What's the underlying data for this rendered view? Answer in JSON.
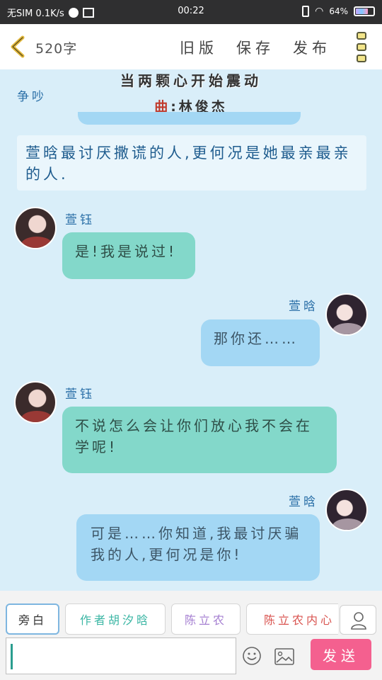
{
  "status": {
    "carrier": "无SIM 0.1K/s",
    "time": "00:22",
    "battery": "64%",
    "battery_level": 0.64
  },
  "topbar": {
    "word_count": "520字",
    "old_version": "旧版",
    "save": "保存",
    "publish": "发布"
  },
  "song": {
    "title": "当两颗心开始震动",
    "artist_prefix": "曲",
    "artist": ":林俊杰"
  },
  "scene_label": "争吵",
  "narration": "萱晗最讨厌撒谎的人,更何况是她最亲最亲的人.",
  "messages": [
    {
      "speaker": "萱钰",
      "side": "left",
      "text": "是!我是说过!"
    },
    {
      "speaker": "萱晗",
      "side": "right",
      "text": "那你还……"
    },
    {
      "speaker": "萱钰",
      "side": "left",
      "text": "不说怎么会让你们放心我不会在学呢!"
    },
    {
      "speaker": "萱晗",
      "side": "right",
      "text": "可是……你知道,我最讨厌骗我的人,更何况是你!"
    }
  ],
  "roles": [
    "旁白",
    "作者胡汐晗",
    "陈立农",
    "陈立农内心"
  ],
  "input": {
    "value": "",
    "placeholder": ""
  },
  "send_label": "发送",
  "colors": {
    "accent": "#f4608f",
    "left_bubble": "#83d8ca",
    "right_bubble": "#a3d7f4",
    "name_color": "#2a6fa7"
  }
}
